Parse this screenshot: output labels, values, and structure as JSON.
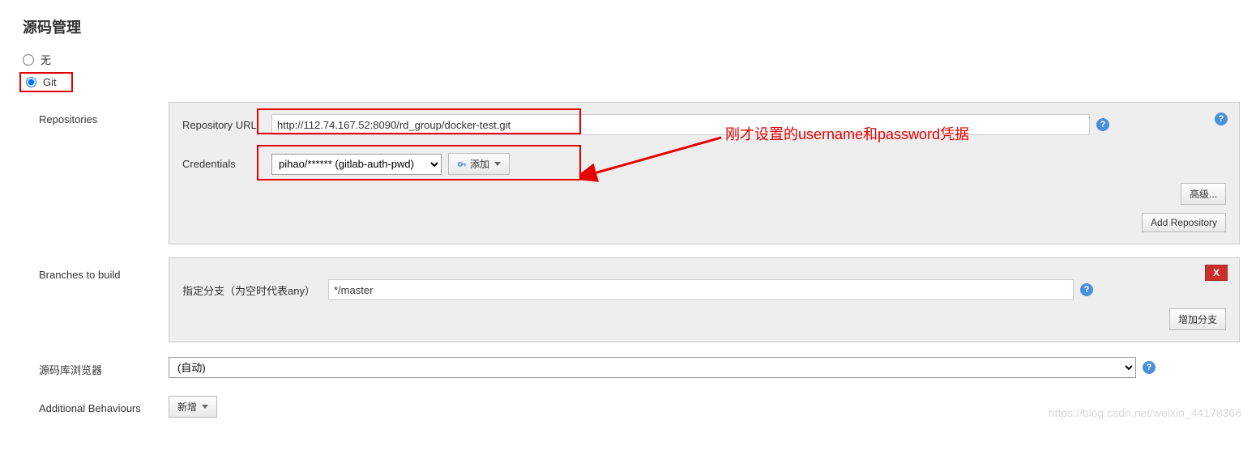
{
  "section_title": "源码管理",
  "scm_options": {
    "none": {
      "label": "无",
      "selected": false
    },
    "git": {
      "label": "Git",
      "selected": true
    }
  },
  "repositories": {
    "heading": "Repositories",
    "repo_url_label": "Repository URL",
    "repo_url_value": "http://112.74.167.52:8090/rd_group/docker-test.git",
    "credentials_label": "Credentials",
    "credentials_selected": "pihao/****** (gitlab-auth-pwd)",
    "add_button": "添加",
    "advanced_button": "高级...",
    "add_repo_button": "Add Repository"
  },
  "branches": {
    "heading": "Branches to build",
    "branch_label": "指定分支（为空时代表any）",
    "branch_value": "*/master",
    "add_branch_button": "增加分支",
    "close_label": "X"
  },
  "browser": {
    "label": "源码库浏览器",
    "selected": "(自动)"
  },
  "additional": {
    "label": "Additional Behaviours",
    "add_button": "新增"
  },
  "annotation_text": "刚才设置的username和password凭据",
  "help_glyph": "?",
  "watermark": "https://blog.csdn.net/weixin_44178366"
}
